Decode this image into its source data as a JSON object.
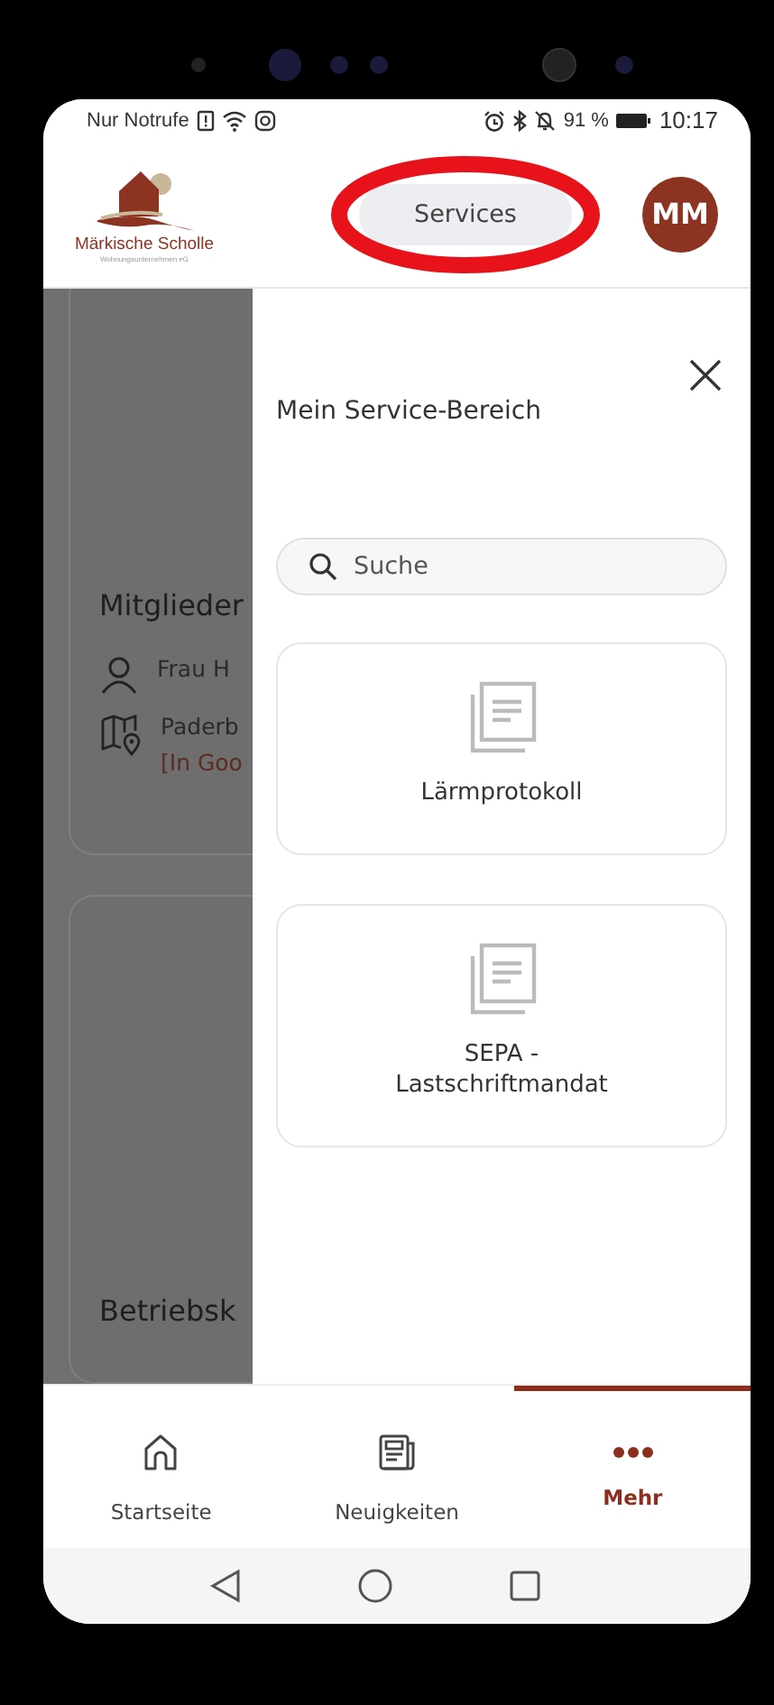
{
  "status_bar": {
    "carrier": "Nur Notrufe",
    "battery": "91 %",
    "time": "10:17"
  },
  "header": {
    "logo_name": "Märkische Scholle",
    "logo_subtitle": "Wohnungsunternehmen eG",
    "services_button": {
      "label": "Services",
      "highlighted": true
    },
    "avatar": "MM"
  },
  "background_page": {
    "sections": [
      {
        "kind": "card",
        "title": "Mitglieder",
        "rows": [
          {
            "kind": "person",
            "lines": [
              "Frau H"
            ]
          },
          {
            "kind": "map",
            "lines": [
              "Paderb",
              "[In Goo"
            ]
          }
        ]
      },
      {
        "kind": "heading",
        "title": "Betriebsk"
      }
    ]
  },
  "drawer": {
    "title": "Mein Service-Bereich",
    "search": {
      "placeholder": "Suche"
    },
    "services": [
      {
        "label": "Lärmprotokoll"
      },
      {
        "label": "SEPA - Lastschriftmandat"
      }
    ]
  },
  "bottom_nav": [
    {
      "label": "Startseite",
      "kind": "home",
      "selected": false
    },
    {
      "label": "Neuigkeiten",
      "kind": "news",
      "selected": false
    },
    {
      "label": "Mehr",
      "kind": "more",
      "selected": true
    }
  ]
}
